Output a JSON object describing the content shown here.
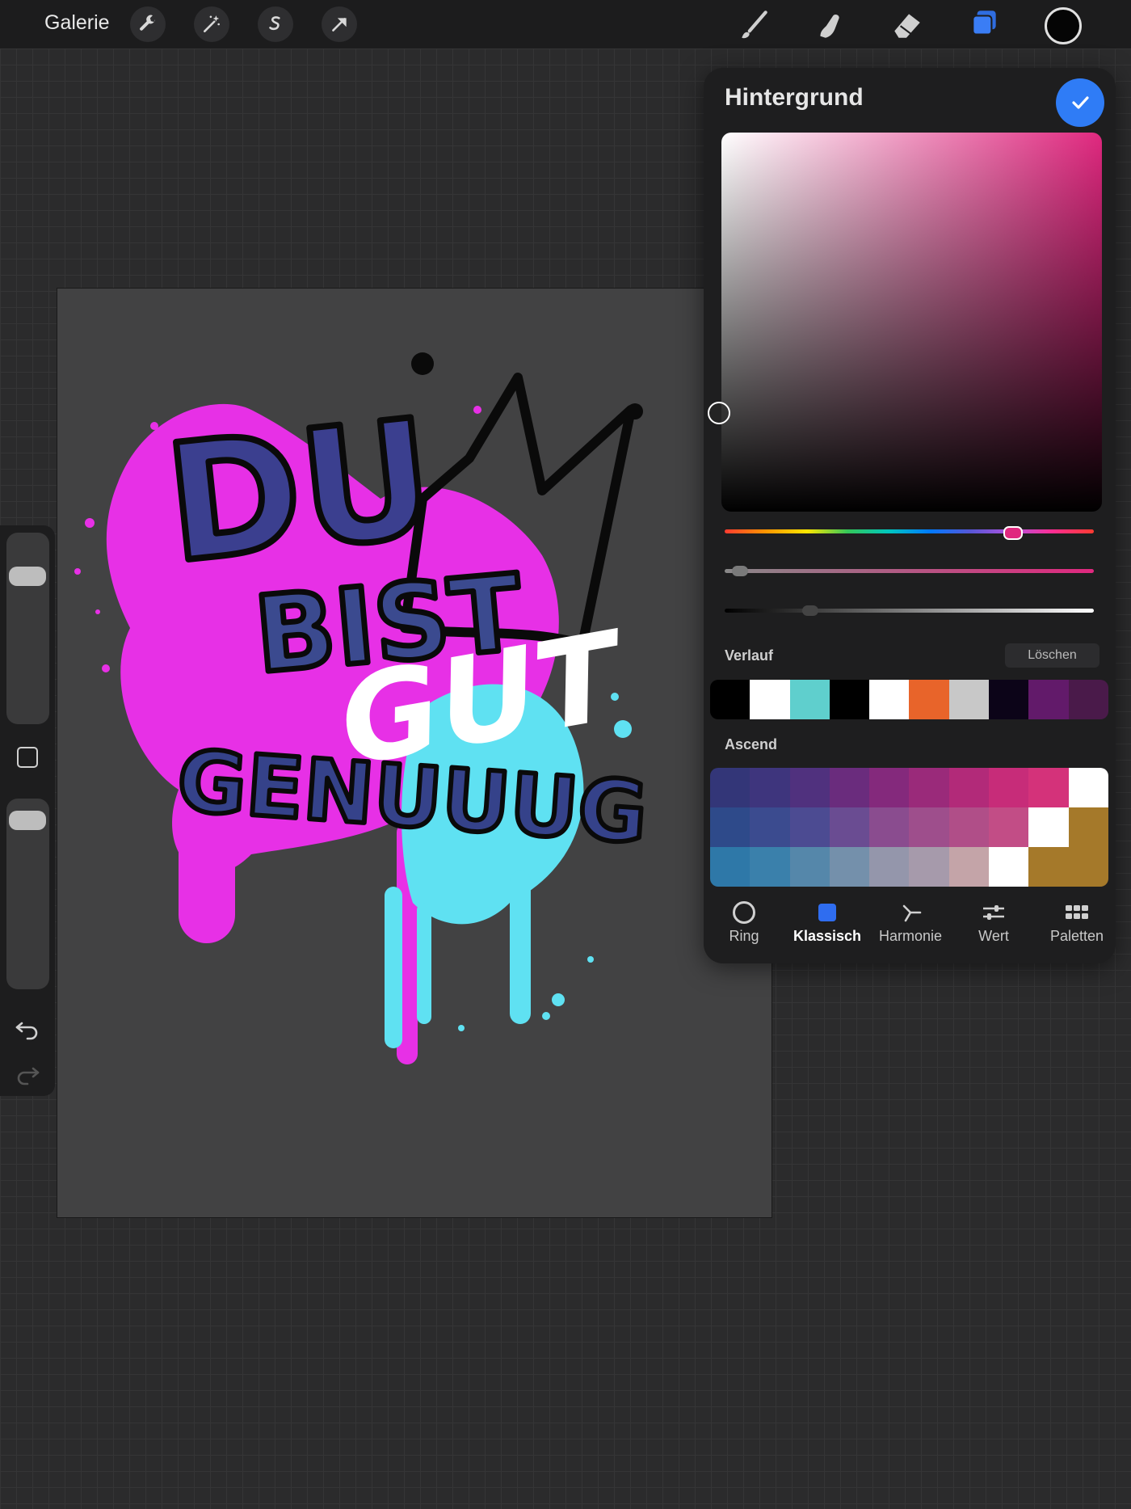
{
  "topbar": {
    "gallery_label": "Galerie",
    "tools_left": [
      "wrench-icon",
      "magic-wand-icon",
      "selection-icon",
      "transform-arrow-icon"
    ],
    "tools_right": [
      "brush-icon",
      "smudge-icon",
      "eraser-icon",
      "layers-icon",
      "color-icon"
    ],
    "active_tool": "layers-icon",
    "current_color": "#050505"
  },
  "artwork": {
    "line1": "DU",
    "line2": "BIST",
    "line3": "GUT",
    "line4": "GENUUUG",
    "colors": {
      "splash_pink": "#e730e6",
      "splash_cyan": "#5fe1f2",
      "letters": "#3b3f8f",
      "crown": "#0a0a0a"
    }
  },
  "color_panel": {
    "title": "Hintergrund",
    "confirm_icon": "checkmark-icon",
    "selected_hue_color": "#e0287f",
    "hue_level": 0.79,
    "saturation_level": 0.02,
    "brightness_level": 0.22,
    "history_label": "Verlauf",
    "clear_label": "Löschen",
    "history_colors": [
      "#000000",
      "#ffffff",
      "#5fcfcd",
      "#000000",
      "#ffffff",
      "#e8642a",
      "#c8c8c8",
      "#0c0418",
      "#621a6a",
      "#4a1a4a"
    ],
    "palette_label": "Ascend",
    "palette_colors": [
      "#333678",
      "#3e357d",
      "#50317e",
      "#6a2c7d",
      "#84297c",
      "#9a2a7a",
      "#b22a79",
      "#c72c79",
      "#d4327a",
      "#ffffff",
      "#2e4a8a",
      "#3b4b8f",
      "#4c4b92",
      "#6a4c92",
      "#8a4c8f",
      "#9e4e8c",
      "#b04e88",
      "#c24d86",
      "#ffffff",
      "#a5792a",
      "#2e78a8",
      "#3a80ab",
      "#5587aa",
      "#7490ab",
      "#9496ab",
      "#a69aab",
      "#c4a4a8",
      "#ffffff",
      "#a5792a",
      "#a5792a"
    ],
    "tabs": [
      {
        "label": "Ring",
        "icon": "ring-icon"
      },
      {
        "label": "Klassisch",
        "icon": "square-icon"
      },
      {
        "label": "Harmonie",
        "icon": "harmony-icon"
      },
      {
        "label": "Wert",
        "icon": "sliders-icon"
      },
      {
        "label": "Paletten",
        "icon": "grid-icon"
      }
    ],
    "active_tab": "Klassisch"
  },
  "sidebar": {
    "brush_size_level": 0.82,
    "opacity_level": 0.95,
    "modify_icon": "square-modify-icon",
    "undo_icon": "undo-icon",
    "redo_icon": "redo-icon"
  }
}
